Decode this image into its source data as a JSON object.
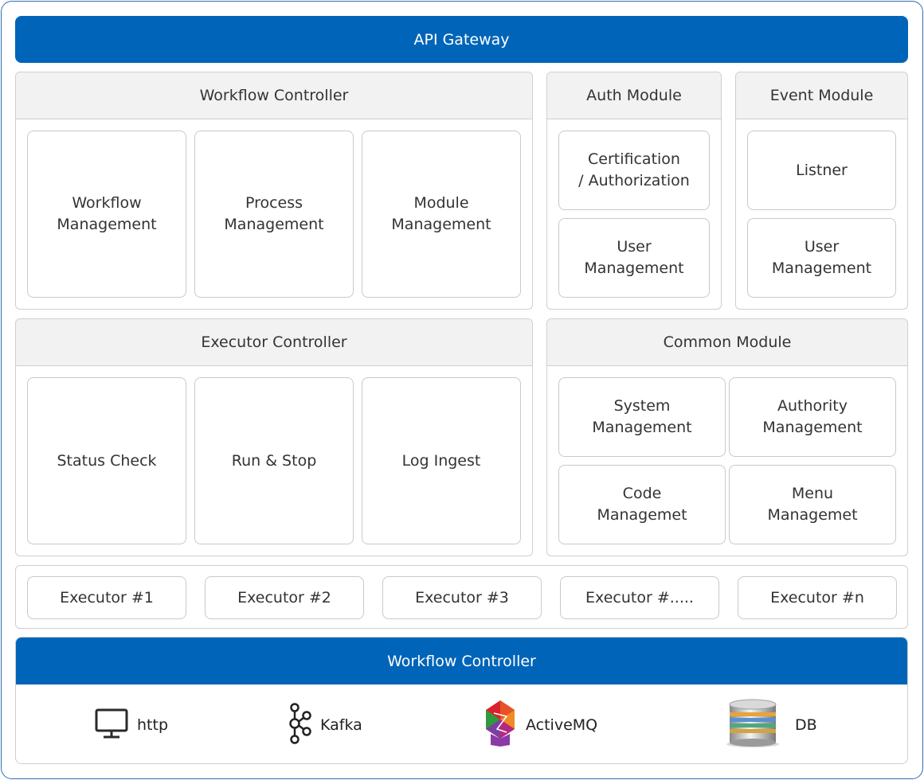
{
  "gateway": {
    "label": "API Gateway"
  },
  "workflow_controller": {
    "title": "Workflow Controller",
    "items": [
      "Workflow\nManagement",
      "Process\nManagement",
      "Module\nManagement"
    ]
  },
  "auth_module": {
    "title": "Auth Module",
    "items": [
      "Certification\n/ Authorization",
      "User\nManagement"
    ]
  },
  "event_module": {
    "title": "Event Module",
    "items": [
      "Listner",
      "User\nManagement"
    ]
  },
  "executor_controller": {
    "title": "Executor Controller",
    "items": [
      "Status Check",
      "Run & Stop",
      "Log Ingest"
    ]
  },
  "common_module": {
    "title": "Common Module",
    "items": [
      "System\nManagement",
      "Authority\nManagement",
      "Code\nManagemet",
      "Menu\nManagemet"
    ]
  },
  "executors": [
    "Executor #1",
    "Executor #2",
    "Executor #3",
    "Executor #.....",
    "Executor #n"
  ],
  "bottom": {
    "title": "Workflow Controller",
    "protocols": [
      {
        "label": "http",
        "icon": "monitor-icon"
      },
      {
        "label": "Kafka",
        "icon": "kafka-icon"
      },
      {
        "label": "ActiveMQ",
        "icon": "activemq-icon"
      },
      {
        "label": "DB",
        "icon": "database-icon"
      }
    ]
  },
  "colors": {
    "primary": "#0065b8",
    "panel_header": "#f2f2f2",
    "border": "#cfcfcf"
  }
}
